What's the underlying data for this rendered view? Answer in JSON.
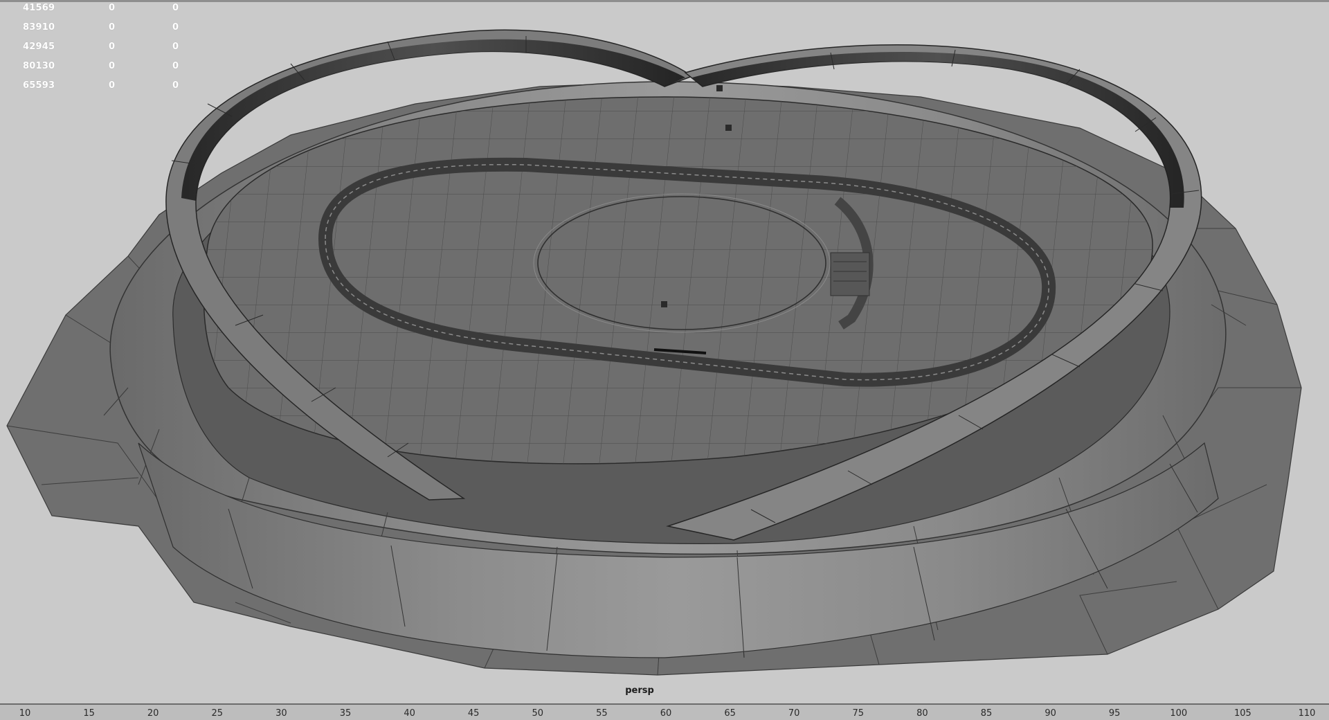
{
  "viewport": {
    "camera_label": "persp",
    "hud_rows": [
      [
        "41569",
        "0",
        "0"
      ],
      [
        "83910",
        "0",
        "0"
      ],
      [
        "42945",
        "0",
        "0"
      ],
      [
        "80130",
        "0",
        "0"
      ],
      [
        "65593",
        "0",
        "0"
      ]
    ]
  },
  "timeline": {
    "ticks": [
      "10",
      "15",
      "20",
      "25",
      "30",
      "35",
      "40",
      "45",
      "50",
      "55",
      "60",
      "65",
      "70",
      "75",
      "80",
      "85",
      "90",
      "95",
      "100",
      "105",
      "110"
    ]
  },
  "colors": {
    "viewport_bg": "#cacaca",
    "mesh_fill": "#7a7a7a",
    "wire": "#2f2f2f",
    "hud_text": "#ffffff"
  }
}
